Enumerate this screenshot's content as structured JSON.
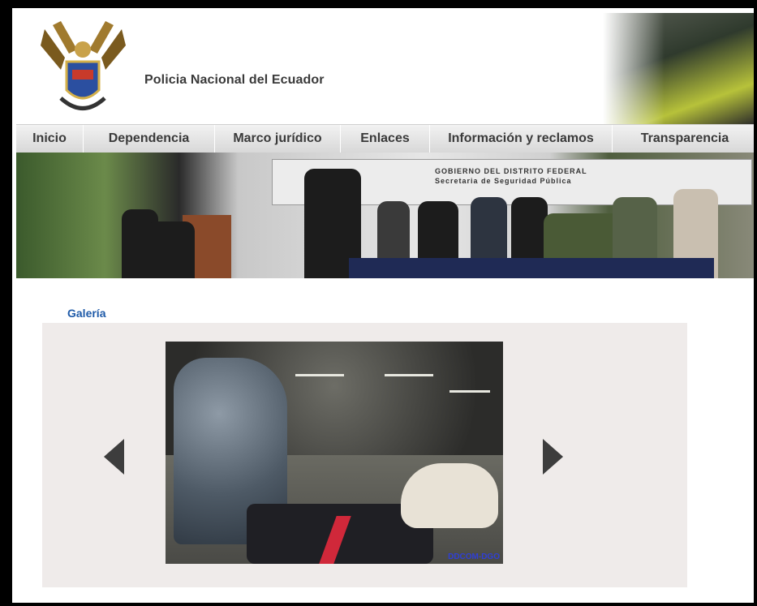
{
  "site": {
    "title": "Policia Nacional del Ecuador"
  },
  "nav": {
    "items": [
      {
        "label": "Inicio"
      },
      {
        "label": "Dependencia"
      },
      {
        "label": "Marco jurídico"
      },
      {
        "label": "Enlaces"
      },
      {
        "label": "Información y reclamos"
      },
      {
        "label": "Transparencia"
      }
    ]
  },
  "banner": {
    "sign_text": "GOBIERNO DEL DISTRITO FEDERAL\nSecretaria de Seguridad Pública"
  },
  "gallery": {
    "title": "Galería",
    "photo_caption": "DDCOM-DGO"
  },
  "colors": {
    "accent": "#1e5aa8",
    "nav_text": "#3a3a3a",
    "gallery_bg": "#efebea",
    "arrow": "#3d3d3d"
  }
}
